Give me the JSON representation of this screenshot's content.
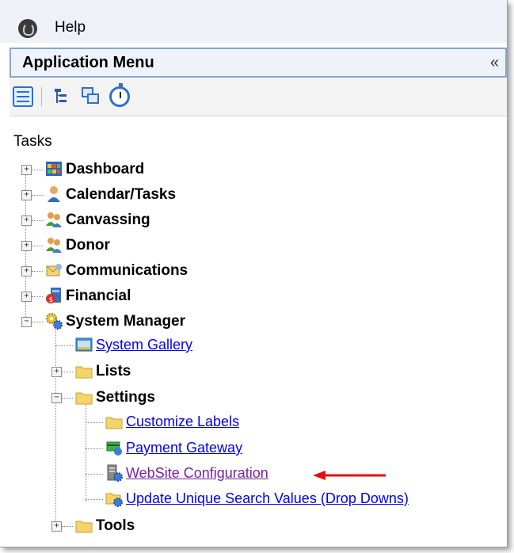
{
  "menubar": {
    "help_label": "Help",
    "logo_icon": "app-logo-icon"
  },
  "app_menu": {
    "title": "Application Menu",
    "collapse_glyph": "«"
  },
  "toolbar": {
    "buttons": [
      "list-view-icon",
      "tree-view-icon",
      "windows-icon",
      "stopwatch-icon"
    ]
  },
  "tasks": {
    "label": "Tasks",
    "items": [
      {
        "label": "Dashboard",
        "icon": "dashboard-icon",
        "expander": "+"
      },
      {
        "label": "Calendar/Tasks",
        "icon": "person-icon",
        "expander": "+"
      },
      {
        "label": "Canvassing",
        "icon": "people-icon",
        "expander": "+"
      },
      {
        "label": "Donor",
        "icon": "people-icon",
        "expander": "+"
      },
      {
        "label": "Communications",
        "icon": "communications-icon",
        "expander": "+"
      },
      {
        "label": "Financial",
        "icon": "financial-icon",
        "expander": "+"
      },
      {
        "label": "System Manager",
        "icon": "gears-icon",
        "expander": "−",
        "children": [
          {
            "label": "System Gallery",
            "icon": "gallery-icon",
            "type": "link"
          },
          {
            "label": "Lists",
            "icon": "folder-icon",
            "expander": "+"
          },
          {
            "label": "Settings",
            "icon": "folder-icon",
            "expander": "−",
            "children": [
              {
                "label": "Customize Labels",
                "icon": "folder-icon",
                "type": "link"
              },
              {
                "label": "Payment Gateway",
                "icon": "payment-icon",
                "type": "link"
              },
              {
                "label": "WebSite Configuration",
                "icon": "server-gear-icon",
                "type": "link",
                "visited": true
              },
              {
                "label": "Update Unique Search Values (Drop Downs)",
                "icon": "folder-gear-icon",
                "type": "link"
              }
            ]
          },
          {
            "label": "Tools",
            "icon": "folder-icon",
            "expander": "+"
          }
        ]
      }
    ]
  },
  "annotation": {
    "arrow_color": "#e01010"
  },
  "colors": {
    "link": "#0000ee",
    "visited_link": "#7a1fa2",
    "header_border": "#86a6d6"
  }
}
